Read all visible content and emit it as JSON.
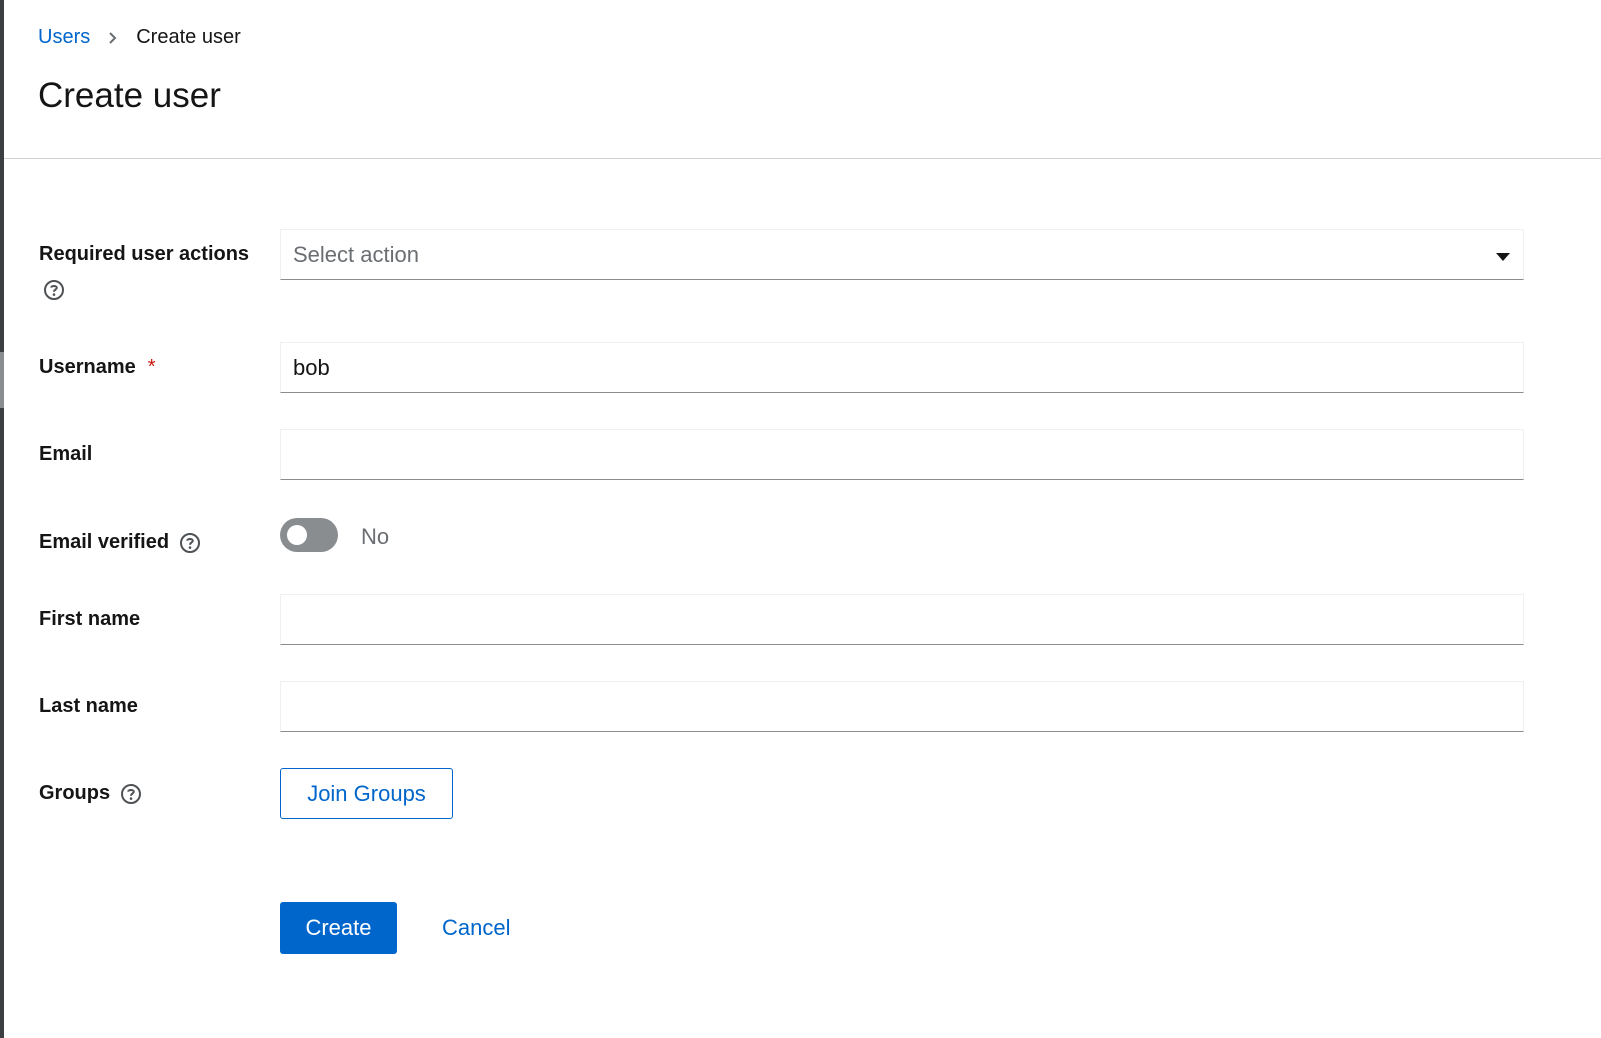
{
  "breadcrumb": {
    "parent_label": "Users",
    "current_label": "Create user"
  },
  "page": {
    "title": "Create user"
  },
  "form": {
    "required_actions": {
      "label": "Required user actions",
      "placeholder": "Select action",
      "help_icon": "help-circle-icon",
      "dropdown_icon": "caret-down-icon"
    },
    "username": {
      "label": "Username",
      "required_marker": "*",
      "value": "bob"
    },
    "email": {
      "label": "Email",
      "value": ""
    },
    "email_verified": {
      "label": "Email verified",
      "state_text": "No",
      "checked": false,
      "help_icon": "help-circle-icon"
    },
    "first_name": {
      "label": "First name",
      "value": ""
    },
    "last_name": {
      "label": "Last name",
      "value": ""
    },
    "groups": {
      "label": "Groups",
      "button_label": "Join Groups",
      "help_icon": "help-circle-icon"
    }
  },
  "actions": {
    "create_label": "Create",
    "cancel_label": "Cancel"
  },
  "colors": {
    "link": "#0066cc",
    "primary": "#0066cc",
    "required": "#c9190b",
    "toggle_off": "#8a8d90",
    "border": "#d2d2d2"
  }
}
